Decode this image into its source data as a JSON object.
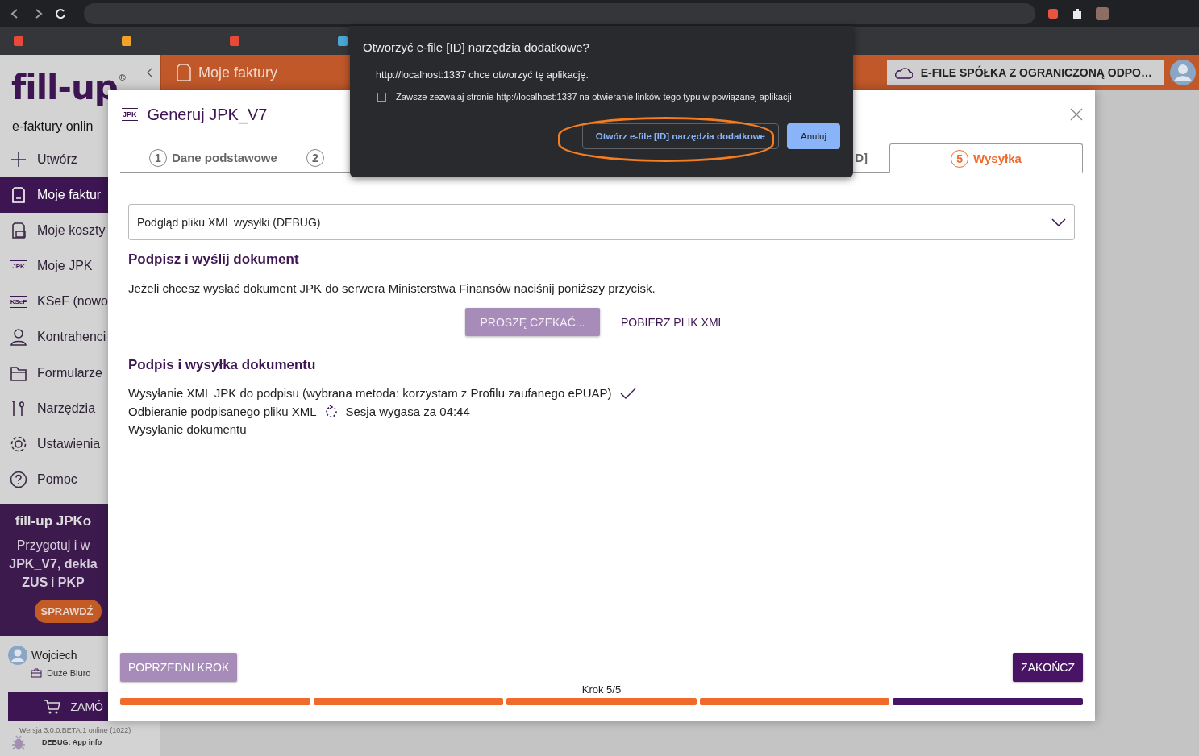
{
  "sidebar": {
    "logo": "fill-up",
    "logo_mark": "®",
    "tagline": "e-faktury onlin",
    "nav": [
      {
        "kind": "plus",
        "label": "Utwórz",
        "selected": false
      },
      {
        "kind": "invoice",
        "label": "Moje faktur",
        "selected": true
      },
      {
        "kind": "costs",
        "label": "Moje koszty",
        "selected": false
      },
      {
        "kind": "badge",
        "badge": "JPK",
        "label": "Moje JPK",
        "selected": false
      },
      {
        "kind": "badge",
        "badge": "KSeF",
        "label": "KSeF (nowo",
        "selected": false
      },
      {
        "kind": "person",
        "label": "Kontrahenci",
        "selected": false
      },
      {
        "kind": "folder",
        "label": "Formularze",
        "selected": false
      },
      {
        "kind": "tools",
        "label": "Narzędzia",
        "selected": false
      },
      {
        "kind": "gear",
        "label": "Ustawienia",
        "selected": false
      },
      {
        "kind": "help",
        "label": "Pomoc",
        "selected": false
      }
    ],
    "promo": {
      "title": "fill-up JPKo",
      "lines": [
        "Przygotuj i w",
        "**JPK_V7, dekla**",
        "**ZUS** i **PKP**"
      ],
      "button": "SPRAWDŹ"
    },
    "user": {
      "name": "Wojciech",
      "plan": "Duże Biuro"
    },
    "order_button": "ZAMÓ",
    "version": "Wersja 3.0.0.BETA.1 online (1022)",
    "debug_link": "DEBUG: App info"
  },
  "header": {
    "title": "Moje faktury",
    "company": "E-FILE SPÓŁKA Z OGRANICZONĄ ODPO…"
  },
  "modal": {
    "badge": "JPK",
    "title": "Generuj JPK_V7",
    "steps": [
      {
        "number": "1",
        "label": "Dane podstawowe",
        "selected": false
      },
      {
        "number": "2",
        "selected": false
      },
      {
        "label": "D]",
        "selected": false
      },
      {
        "number": "5",
        "label": "Wysyłka",
        "selected": true
      }
    ],
    "preview_dropdown": "Podgląd pliku XML wysyłki (DEBUG)",
    "sign_heading": "Podpisz i wyślij dokument",
    "sign_text": "Jeżeli chcesz wysłać dokument JPK do serwera Ministerstwa Finansów naciśnij poniższy przycisk.",
    "wait_button": {
      "label": "PROSZĘ CZEKAĆ...",
      "disabled": true
    },
    "download_link": "POBIERZ PLIK XML",
    "status_heading": "Podpis i wysyłka dokumentu",
    "status_lines": [
      {
        "text": "Wysyłanie XML JPK do podpisu (wybrana metoda: korzystam z Profilu zaufanego ePUAP)",
        "kind": "done"
      },
      {
        "text": "Odbieranie podpisanego pliku XML",
        "kind": "pending",
        "note": "Sesja wygasa za 04:44"
      },
      {
        "text": "Wysyłanie dokumentu",
        "kind": "waiting"
      }
    ],
    "prev_button": {
      "label": "POPRZEDNI KROK",
      "disabled": true
    },
    "finish_button": "ZAKOŃCZ",
    "progress_caption": "Krok 5/5",
    "progress": [
      {
        "kind": "done"
      },
      {
        "kind": "done"
      },
      {
        "kind": "done"
      },
      {
        "kind": "done"
      },
      {
        "kind": "current"
      }
    ]
  },
  "dialog": {
    "title": "Otworzyć e-file [ID] narzędzia dodatkowe?",
    "message": "http://localhost:1337 chce otworzyć tę aplikację.",
    "always_allow": {
      "label": "Zawsze zezwalaj stronie http://localhost:1337 na otwieranie linków tego typu w powiązanej aplikacji",
      "checked": false
    },
    "open_button": "Otwórz e-file [ID] narzędzia dodatkowe",
    "cancel_button": "Anuluj",
    "highlighted": true
  }
}
